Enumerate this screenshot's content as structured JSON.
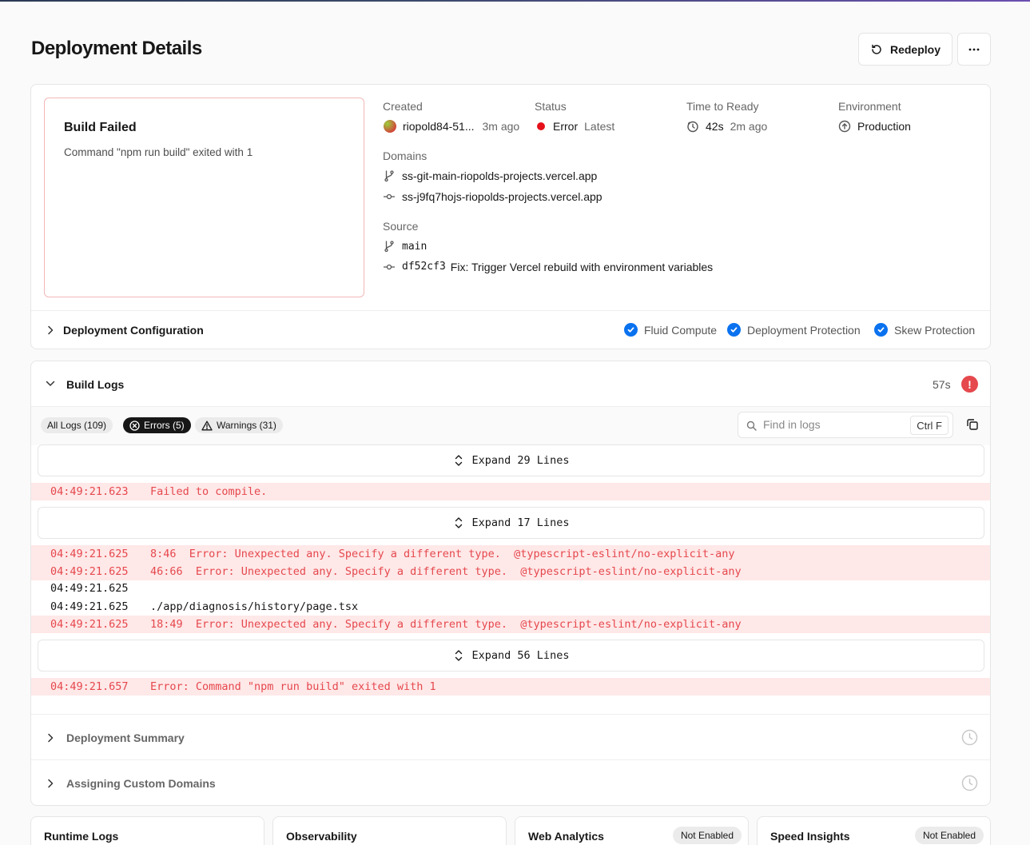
{
  "page": {
    "title": "Deployment Details"
  },
  "actions": {
    "redeploy_label": "Redeploy"
  },
  "summary": {
    "status_title": "Build Failed",
    "status_message": "Command \"npm run build\" exited with 1",
    "created": {
      "label": "Created",
      "author": "riopold84-51...",
      "ago": "3m ago"
    },
    "status": {
      "label": "Status",
      "value": "Error",
      "tag": "Latest",
      "color": "#e5101a"
    },
    "time_to_ready": {
      "label": "Time to Ready",
      "duration": "42s",
      "ago": "2m ago"
    },
    "environment": {
      "label": "Environment",
      "value": "Production"
    },
    "domains": {
      "label": "Domains",
      "items": [
        "ss-git-main-riopolds-projects.vercel.app",
        "ss-j9fq7hojs-riopolds-projects.vercel.app"
      ]
    },
    "source": {
      "label": "Source",
      "branch": "main",
      "commit_hash": "df52cf3",
      "commit_message": "Fix: Trigger Vercel rebuild with environment variables"
    }
  },
  "config": {
    "title": "Deployment Configuration",
    "features": [
      "Fluid Compute",
      "Deployment Protection",
      "Skew Protection"
    ],
    "accent": "#0a72ef"
  },
  "build_logs": {
    "title": "Build Logs",
    "duration": "57s",
    "error_icon": "!",
    "filters": {
      "all": "All Logs (109)",
      "errors": "Errors (5)",
      "warnings": "Warnings (31)"
    },
    "search_placeholder": "Find in logs",
    "shortcut": "Ctrl F",
    "expand": [
      "Expand 29 Lines",
      "Expand 17 Lines",
      "Expand 56 Lines"
    ],
    "lines": [
      {
        "ts": "04:49:21.623",
        "msg": "Failed to compile.",
        "level": "error"
      },
      {
        "ts": "04:49:21.625",
        "msg": "8:46  Error: Unexpected any. Specify a different type.  @typescript-eslint/no-explicit-any",
        "level": "error"
      },
      {
        "ts": "04:49:21.625",
        "msg": "46:66  Error: Unexpected any. Specify a different type.  @typescript-eslint/no-explicit-any",
        "level": "error"
      },
      {
        "ts": "04:49:21.625",
        "msg": "",
        "level": "plain"
      },
      {
        "ts": "04:49:21.625",
        "msg": "./app/diagnosis/history/page.tsx",
        "level": "plain"
      },
      {
        "ts": "04:49:21.625",
        "msg": "18:49  Error: Unexpected any. Specify a different type.  @typescript-eslint/no-explicit-any",
        "level": "error"
      },
      {
        "ts": "04:49:21.657",
        "msg": "Error: Command \"npm run build\" exited with 1",
        "level": "error"
      }
    ]
  },
  "sections": [
    "Deployment Summary",
    "Assigning Custom Domains"
  ],
  "bottom_cards": [
    {
      "title": "Runtime Logs",
      "badge": ""
    },
    {
      "title": "Observability",
      "badge": ""
    },
    {
      "title": "Web Analytics",
      "badge": "Not Enabled"
    },
    {
      "title": "Speed Insights",
      "badge": "Not Enabled"
    }
  ]
}
